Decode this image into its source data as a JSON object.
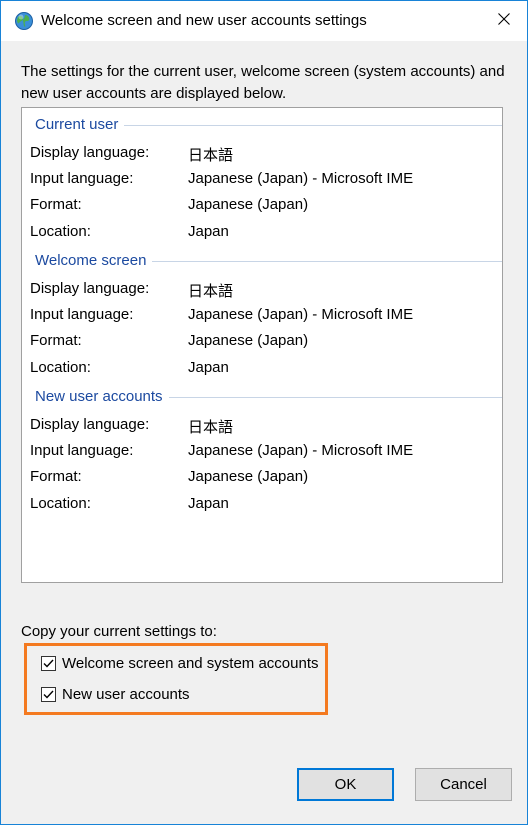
{
  "window": {
    "title": "Welcome screen and new user accounts settings",
    "icon": "globe-icon",
    "close_icon": "close-icon"
  },
  "intro": "The settings for the current user, welcome screen (system accounts) and new user accounts are displayed below.",
  "labels": {
    "display_language": "Display language:",
    "input_language": "Input language:",
    "format": "Format:",
    "location": "Location:"
  },
  "sections": [
    {
      "title": "Current user",
      "display_language": "日本語",
      "input_language": "Japanese (Japan) - Microsoft IME",
      "format": "Japanese (Japan)",
      "location": "Japan"
    },
    {
      "title": "Welcome screen",
      "display_language": "日本語",
      "input_language": "Japanese (Japan) - Microsoft IME",
      "format": "Japanese (Japan)",
      "location": "Japan"
    },
    {
      "title": "New user accounts",
      "display_language": "日本語",
      "input_language": "Japanese (Japan) - Microsoft IME",
      "format": "Japanese (Japan)",
      "location": "Japan"
    }
  ],
  "copy": {
    "label": "Copy your current settings to:",
    "options": [
      {
        "label": "Welcome screen and system accounts",
        "checked": true
      },
      {
        "label": "New user accounts",
        "checked": true
      }
    ]
  },
  "buttons": {
    "ok": "OK",
    "cancel": "Cancel"
  },
  "colors": {
    "section_header": "#1c4aa0",
    "highlight": "#f47a20",
    "window_border": "#1883d7",
    "primary_button_border": "#0078d7"
  }
}
